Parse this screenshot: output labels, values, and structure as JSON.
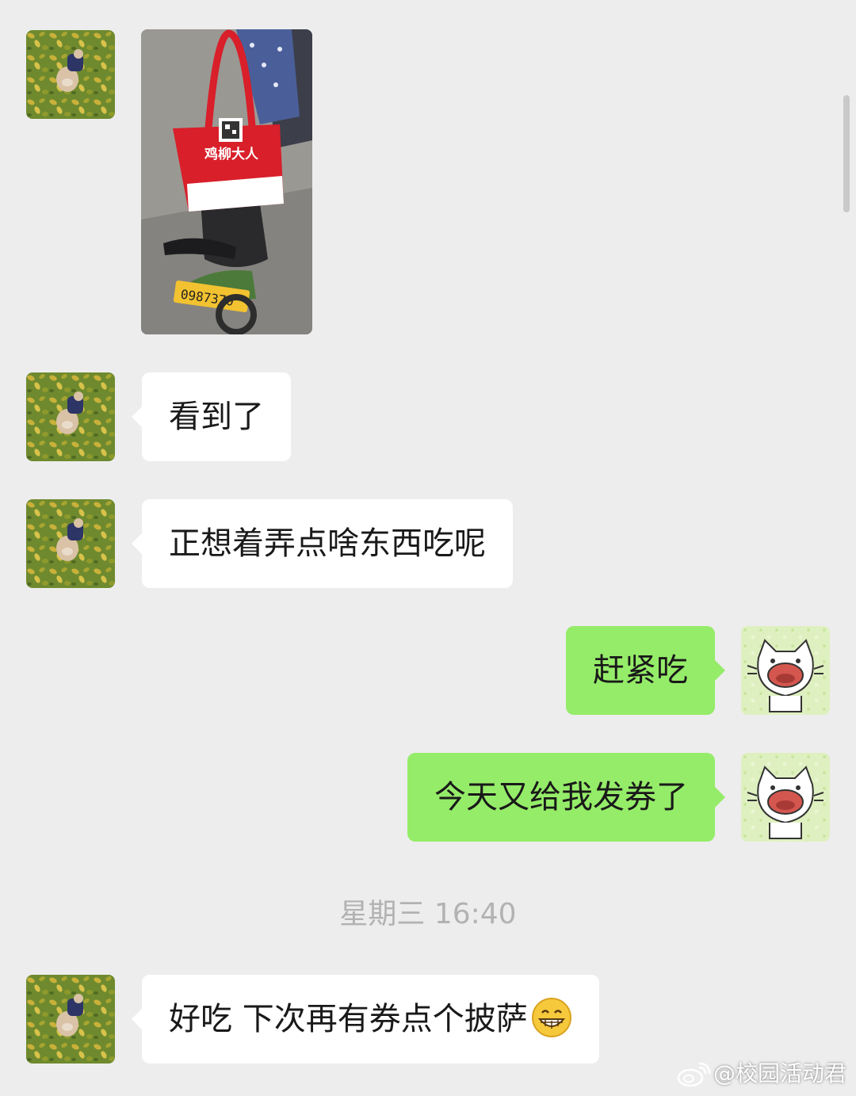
{
  "messages": [
    {
      "sender": "contact",
      "type": "image",
      "description_icon": "photo-bike-bag"
    },
    {
      "sender": "contact",
      "type": "text",
      "text": "看到了"
    },
    {
      "sender": "contact",
      "type": "text",
      "text": "正想着弄点啥东西吃呢"
    },
    {
      "sender": "me",
      "type": "text",
      "text": "赶紧吃"
    },
    {
      "sender": "me",
      "type": "text",
      "text": "今天又给我发券了"
    },
    {
      "sender": "contact",
      "type": "text",
      "text": "好吃 下次再有券点个披萨",
      "emoji": "grinning-face-icon"
    }
  ],
  "timestamp": "星期三 16:40",
  "photo": {
    "bag_text": "鸡柳大人",
    "plate_text": "0987370"
  },
  "watermark": "@校园活动君",
  "colors": {
    "background": "#ededed",
    "incoming_bubble": "#ffffff",
    "outgoing_bubble": "#95ec69",
    "timestamp_text": "#b2b2b2"
  }
}
